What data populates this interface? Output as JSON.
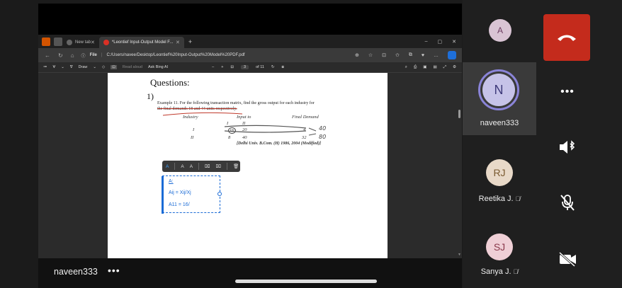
{
  "browser": {
    "tabs": [
      {
        "label": "New tab"
      },
      {
        "label": "*Leontief Input-Output Model F..."
      }
    ],
    "new_tab_symbol": "+",
    "window_controls": [
      "–",
      "▢",
      "✕"
    ],
    "address": {
      "prefix": "File",
      "url": "C:/Users/navee/Desktop/Leontief%20Input-Output%20Model%20PDF.pdf"
    }
  },
  "pdf_toolbar": {
    "draw_label": "Draw",
    "read_aloud_label": "Read aloud",
    "ask_bing_label": "Ask Bing AI",
    "zoom_minus": "–",
    "zoom_plus": "+",
    "page_current": "3",
    "page_total": "of 11"
  },
  "document": {
    "heading": "Questions:",
    "question_number": "1)",
    "example_text_1": "Example 11. For the following transaction matrix, find the gross output for each industry for",
    "example_text_2": "the final demands 18 and 44 units respectively.",
    "col_industry": "Industry",
    "col_input_to": "Input to",
    "col_final_demand": "Final Demand",
    "roman_i": "I",
    "roman_ii": "II",
    "val_16": "16",
    "val_20": "20",
    "val_8": "8",
    "val_40": "40",
    "val_4": "4",
    "val_32": "32",
    "hw_40": "40",
    "hw_80": "80",
    "source": "[Delhi Univ. B.Com. (H) 1986, 2004 (Modified)]"
  },
  "annotation": {
    "toolbar_items": [
      "A",
      "A",
      "A",
      "⌧",
      "⌧",
      "🗑"
    ],
    "lines": [
      "A:",
      "Aij = Xij/Xj",
      "A11 = 16/"
    ]
  },
  "self_view": {
    "name": "naveen333",
    "more": "•••"
  },
  "participants": [
    {
      "initials": "A",
      "name": "",
      "muted": false,
      "color": "#d9c4d4"
    },
    {
      "initials": "N",
      "name": "naveen333",
      "muted": false,
      "color": "#c6c3e8"
    },
    {
      "initials": "RJ",
      "name": "Reetika J.",
      "muted": true,
      "color": "#e8d9c8"
    },
    {
      "initials": "SJ",
      "name": "Sanya J.",
      "muted": true,
      "color": "#efcfd6"
    }
  ],
  "controls": {
    "hangup": "hang-up",
    "more": "•••",
    "speaker": "speaker",
    "mic": "mic-off",
    "camera": "camera-off"
  },
  "colors": {
    "hangup": "#c42b1c",
    "accent": "#1a6bd6"
  }
}
